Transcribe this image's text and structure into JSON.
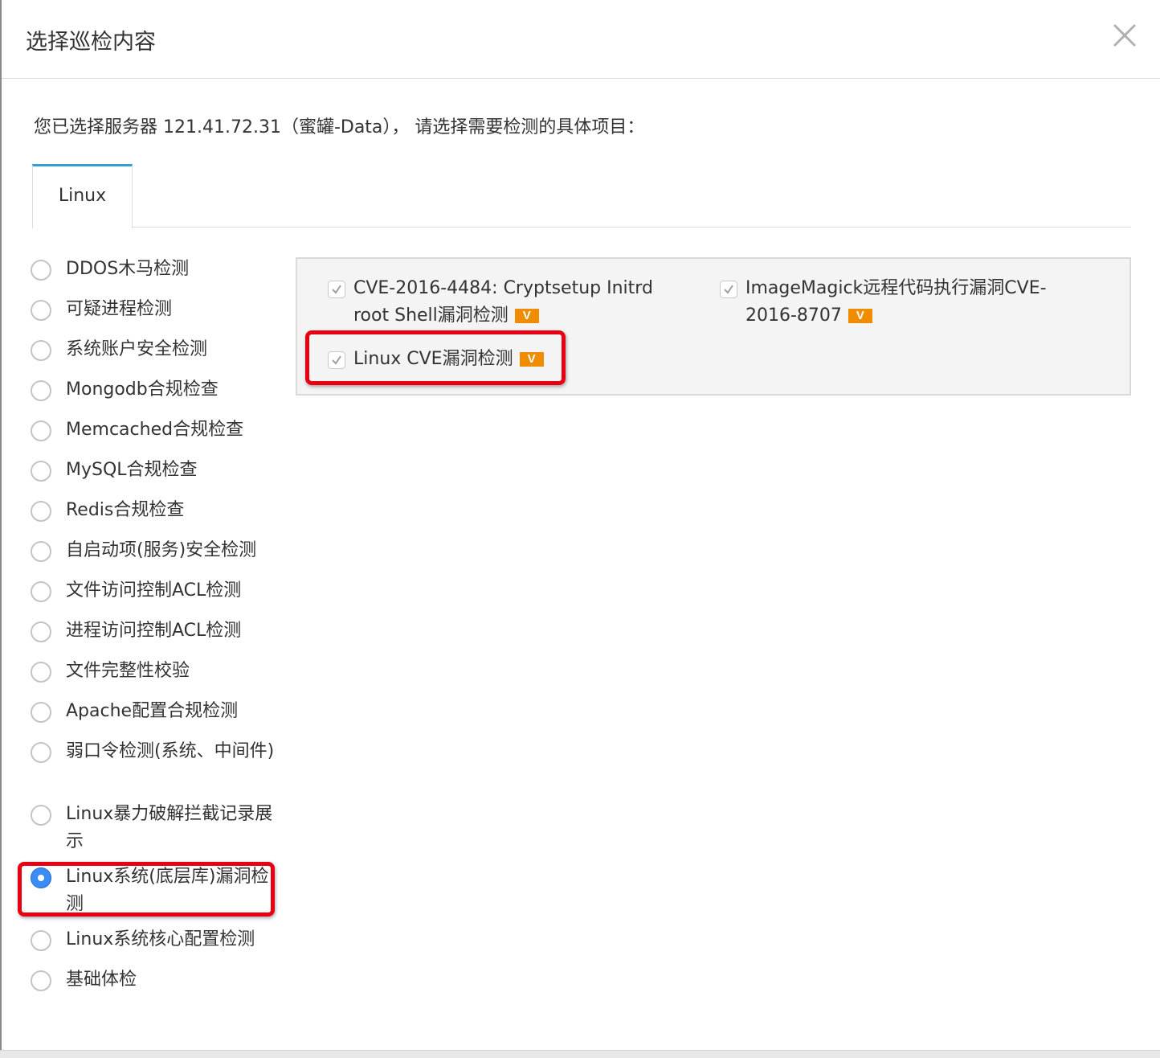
{
  "dialog": {
    "title": "选择巡检内容",
    "description": "您已选择服务器 121.41.72.31（蜜罐-Data）， 请选择需要检测的具体项目："
  },
  "tabs": [
    {
      "label": "Linux",
      "active": true
    }
  ],
  "categories": [
    {
      "label": "DDOS木马检测",
      "selected": false
    },
    {
      "label": "可疑进程检测",
      "selected": false
    },
    {
      "label": "系统账户安全检测",
      "selected": false
    },
    {
      "label": "Mongodb合规检查",
      "selected": false
    },
    {
      "label": "Memcached合规检查",
      "selected": false
    },
    {
      "label": "MySQL合规检查",
      "selected": false
    },
    {
      "label": "Redis合规检查",
      "selected": false
    },
    {
      "label": "自启动项(服务)安全检测",
      "selected": false
    },
    {
      "label": "文件访问控制ACL检测",
      "selected": false
    },
    {
      "label": "进程访问控制ACL检测",
      "selected": false
    },
    {
      "label": "文件完整性校验",
      "selected": false
    },
    {
      "label": "Apache配置合规检测",
      "selected": false
    },
    {
      "label": "弱口令检测(系统、中间件)",
      "selected": false
    },
    {
      "label": "Linux暴力破解拦截记录展示",
      "selected": false
    },
    {
      "label": "Linux系统(底层库)漏洞检测",
      "selected": true
    },
    {
      "label": "Linux系统核心配置检测",
      "selected": false
    },
    {
      "label": "基础体检",
      "selected": false
    }
  ],
  "items": [
    {
      "label": "CVE-2016-4484: Cryptsetup Initrd root Shell漏洞检测",
      "badge": "V",
      "checked": true
    },
    {
      "label": "ImageMagick远程代码执行漏洞CVE-2016-8707",
      "badge": "V",
      "checked": true
    },
    {
      "label": "Linux CVE漏洞检测",
      "badge": "V",
      "checked": true
    }
  ],
  "colors": {
    "tab_accent": "#2e9fd7",
    "badge": "#f08c00",
    "radio_selected": "#3d8bf5",
    "highlight": "#e60012"
  }
}
